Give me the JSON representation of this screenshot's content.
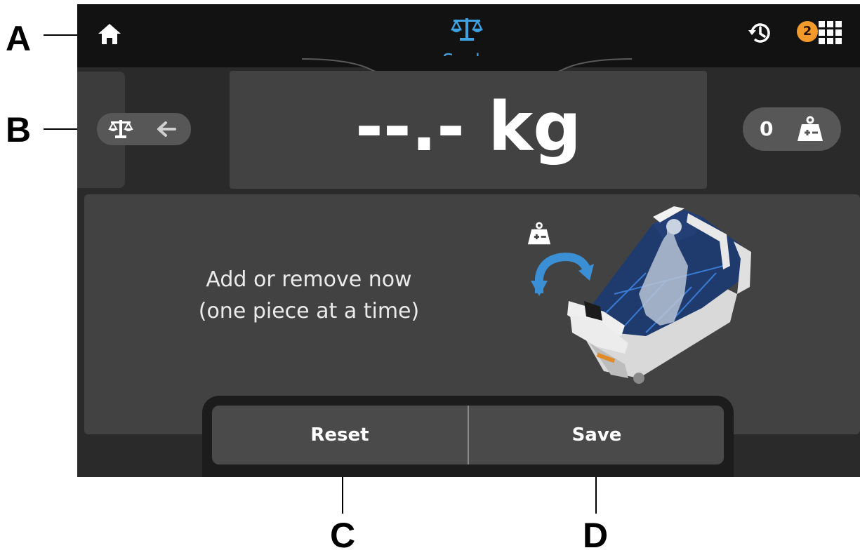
{
  "callouts": {
    "a": "A",
    "b": "B",
    "c": "C",
    "d": "D"
  },
  "header": {
    "title": "Scale",
    "left_icon": "home-icon",
    "center_icon": "scale-icon",
    "right_icons": [
      "history-icon",
      "apps-grid-icon"
    ],
    "notification_count": "2"
  },
  "scale_mode_toggle": {
    "icons": [
      "scale-icon",
      "arrow-left-icon"
    ]
  },
  "readout": {
    "value": "--.- kg"
  },
  "equipment_counter": {
    "count": "0",
    "icon": "add-remove-weight-icon"
  },
  "instruction": {
    "line1": "Add or remove now",
    "line2": "(one piece at a time)"
  },
  "illustration": {
    "icons": [
      "add-remove-weight-icon",
      "curved-arrow-icon",
      "hospital-bed-with-patient"
    ]
  },
  "buttons": {
    "reset": "Reset",
    "save": "Save"
  },
  "colors": {
    "accent": "#3ea2e0",
    "badge": "#f39a2a",
    "background": "#2a2a2a",
    "topbar": "#121212",
    "panel": "#3c3c3c"
  }
}
